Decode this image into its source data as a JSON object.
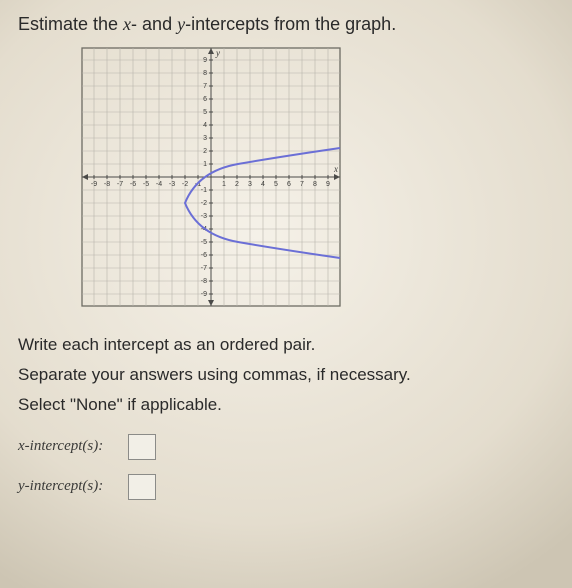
{
  "question": {
    "prefix": "Estimate the ",
    "xvar": "x",
    "dash": "-",
    "and": " and ",
    "yvar": "y",
    "suffix": "-intercepts from the graph."
  },
  "graph": {
    "xlabel": "x",
    "ylabel": "y",
    "ticks_neg": [
      "-9",
      "-8",
      "-7",
      "-6",
      "-5",
      "-4",
      "-3",
      "-2",
      "-1"
    ],
    "ticks_pos": [
      "1",
      "2",
      "3",
      "4",
      "5",
      "6",
      "7",
      "8",
      "9"
    ]
  },
  "instructions": {
    "line1": "Write each intercept as an ordered pair.",
    "line2": "Separate your answers using commas, if necessary.",
    "line3": "Select \"None\" if applicable."
  },
  "answers": {
    "x_label": "x-intercept(s):",
    "y_label": "y-intercept(s):",
    "x_value": "",
    "y_value": ""
  },
  "chart_data": {
    "type": "scatter",
    "title": "",
    "xlabel": "x",
    "ylabel": "y",
    "xlim": [
      -9,
      9
    ],
    "ylim": [
      -9,
      9
    ],
    "series": [
      {
        "name": "curve",
        "description": "sideways parabola opening right, vertex approx (-2,-2)",
        "x": [
          9,
          7,
          5,
          3,
          1,
          -1,
          -2,
          -1,
          1,
          3,
          5,
          7,
          9
        ],
        "y": [
          2.2,
          1.8,
          1.3,
          0.7,
          0.1,
          -0.7,
          -2.0,
          -3.3,
          -4.1,
          -4.7,
          -5.3,
          -5.8,
          -6.2
        ]
      }
    ],
    "x_intercepts_estimate": [
      [
        1,
        0
      ]
    ],
    "y_intercepts_estimate": [
      [
        0,
        -0.4
      ],
      [
        0,
        -3.6
      ]
    ]
  }
}
